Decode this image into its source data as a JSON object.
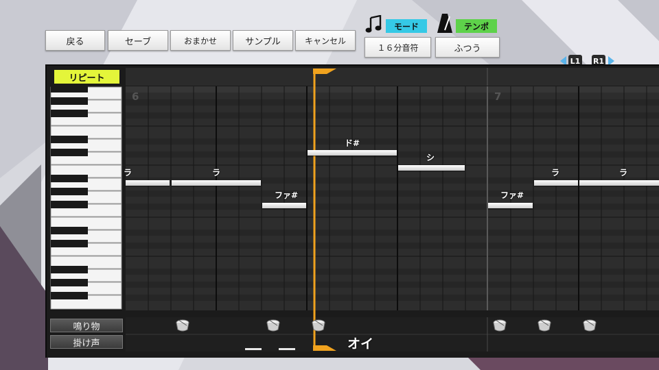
{
  "toolbar": {
    "back": "戻る",
    "save": "セーブ",
    "auto": "おまかせ",
    "sample": "サンプル",
    "cancel": "キャンセル"
  },
  "mode": {
    "label": "モード",
    "value": "１６分音符"
  },
  "tempo": {
    "label": "テンポ",
    "value": "ふつう"
  },
  "shoulder": {
    "l1": "L1",
    "r1": "R1"
  },
  "repeat_label": "リピート",
  "measures": {
    "left": "6",
    "right": "7"
  },
  "notes": [
    {
      "label": "ラ"
    },
    {
      "label": "ラ"
    },
    {
      "label": "ファ#"
    },
    {
      "label": "ド#"
    },
    {
      "label": "シ"
    },
    {
      "label": "ファ#"
    },
    {
      "label": "ラ"
    },
    {
      "label": "ラ"
    }
  ],
  "rows": {
    "narimono": "鳴り物",
    "kakegoe": "掛け声"
  },
  "kakegoe_text": "オイ",
  "colors": {
    "repeat": "#e4f53a",
    "mode_tag": "#35c9e6",
    "tempo_tag": "#5ed24a",
    "playhead": "#f0a21e"
  },
  "icons": {
    "mode": "music-note-icon",
    "tempo": "metronome-icon",
    "drum": "drum-icon"
  }
}
